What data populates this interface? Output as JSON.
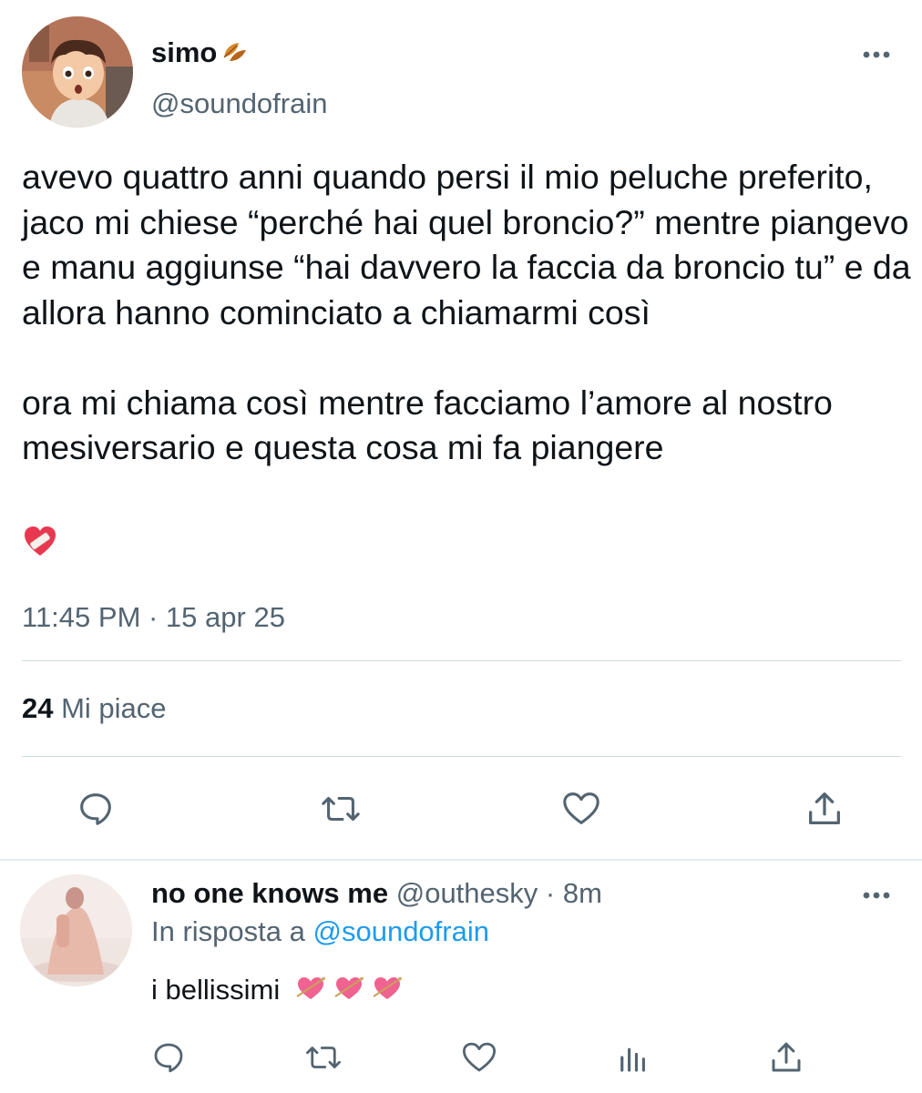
{
  "tweet": {
    "author_name": "simo",
    "author_handle": "@soundofrain",
    "text": "avevo quattro anni quando persi il mio peluche preferito, jaco mi chiese “perché hai quel broncio?” mentre piangevo e manu aggiunse “hai davvero la faccia da broncio tu” e da allora hanno cominciato a chiamarmi così\n\nora mi chiama così mentre facciamo l’amore al nostro mesiversario e questa cosa mi fa piangere",
    "timestamp": "11:45 PM · 15 apr 25",
    "likes_count": "24",
    "likes_label": "Mi piace",
    "name_emoji": "fallen-leaf-icon",
    "trailing_emoji": "mending-heart-icon"
  },
  "reply": {
    "author_name": "no one knows me",
    "author_handle": "@outhesky",
    "time": "8m",
    "reply_prefix": "In risposta a",
    "reply_to_handle": "@soundofrain",
    "text": "i bellissimi",
    "emojis": [
      "heart-with-arrow-icon",
      "heart-with-arrow-icon",
      "heart-with-arrow-icon"
    ]
  },
  "colors": {
    "primary_text": "#0f1419",
    "secondary_text": "#536471",
    "link": "#1d9bf0",
    "divider": "#cfd9de",
    "icon": "#536471"
  }
}
